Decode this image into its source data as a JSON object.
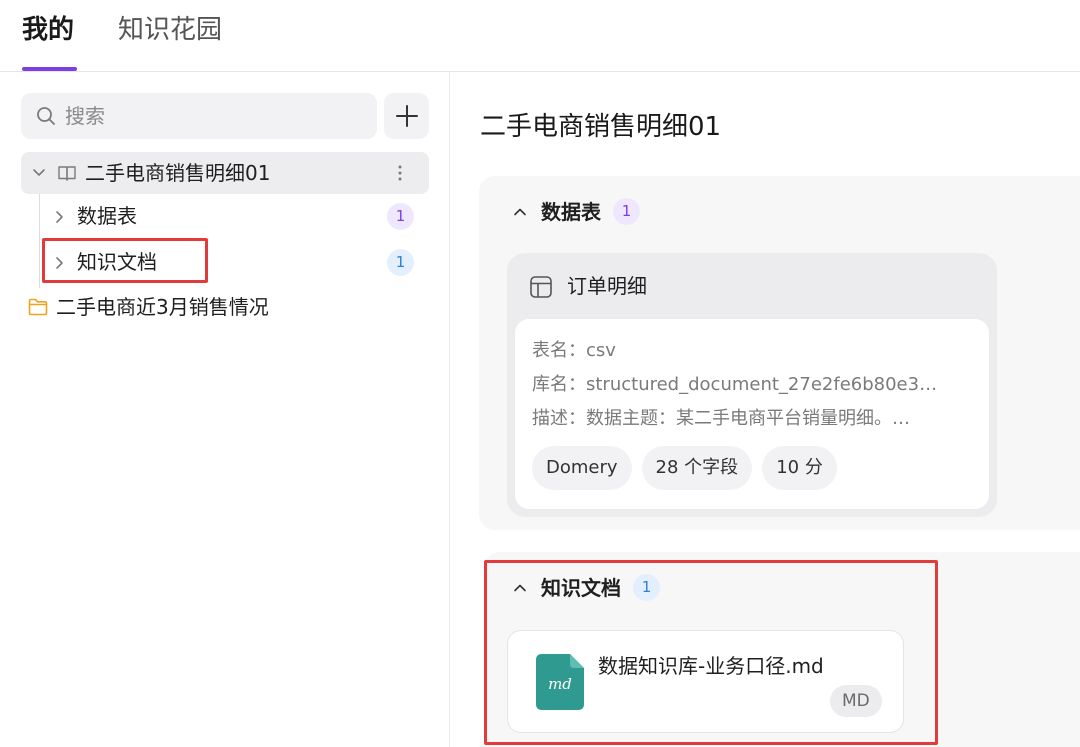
{
  "tabs": [
    {
      "label": "我的",
      "active": true
    },
    {
      "label": "知识花园",
      "active": false
    }
  ],
  "accent_color": "#7b3fe4",
  "sidebar": {
    "search_placeholder": "搜索",
    "tree": {
      "root_label": "二手电商销售明细01",
      "children": [
        {
          "label": "数据表",
          "count": "1"
        },
        {
          "label": "知识文档",
          "count": "1"
        }
      ]
    },
    "folder_label": "二手电商近3月销售情况"
  },
  "main": {
    "title": "二手电商销售明细01",
    "data_section": {
      "title": "数据表",
      "count": "1",
      "card": {
        "title": "订单明细",
        "table_name": "表名：csv",
        "db_name": "库名：structured_document_27e2fe6b80e3…",
        "description": "描述：数据主题：某二手电商平台销量明细。…",
        "chips": [
          "Domery",
          "28 个字段",
          "10 分"
        ]
      }
    },
    "doc_section": {
      "title": "知识文档",
      "count": "1",
      "doc": {
        "name": "数据知识库-业务口径.md",
        "type_badge": "MD",
        "icon_text": "md",
        "icon_color": "#2f9a8f"
      }
    }
  },
  "highlight_color": "#e23b3b"
}
